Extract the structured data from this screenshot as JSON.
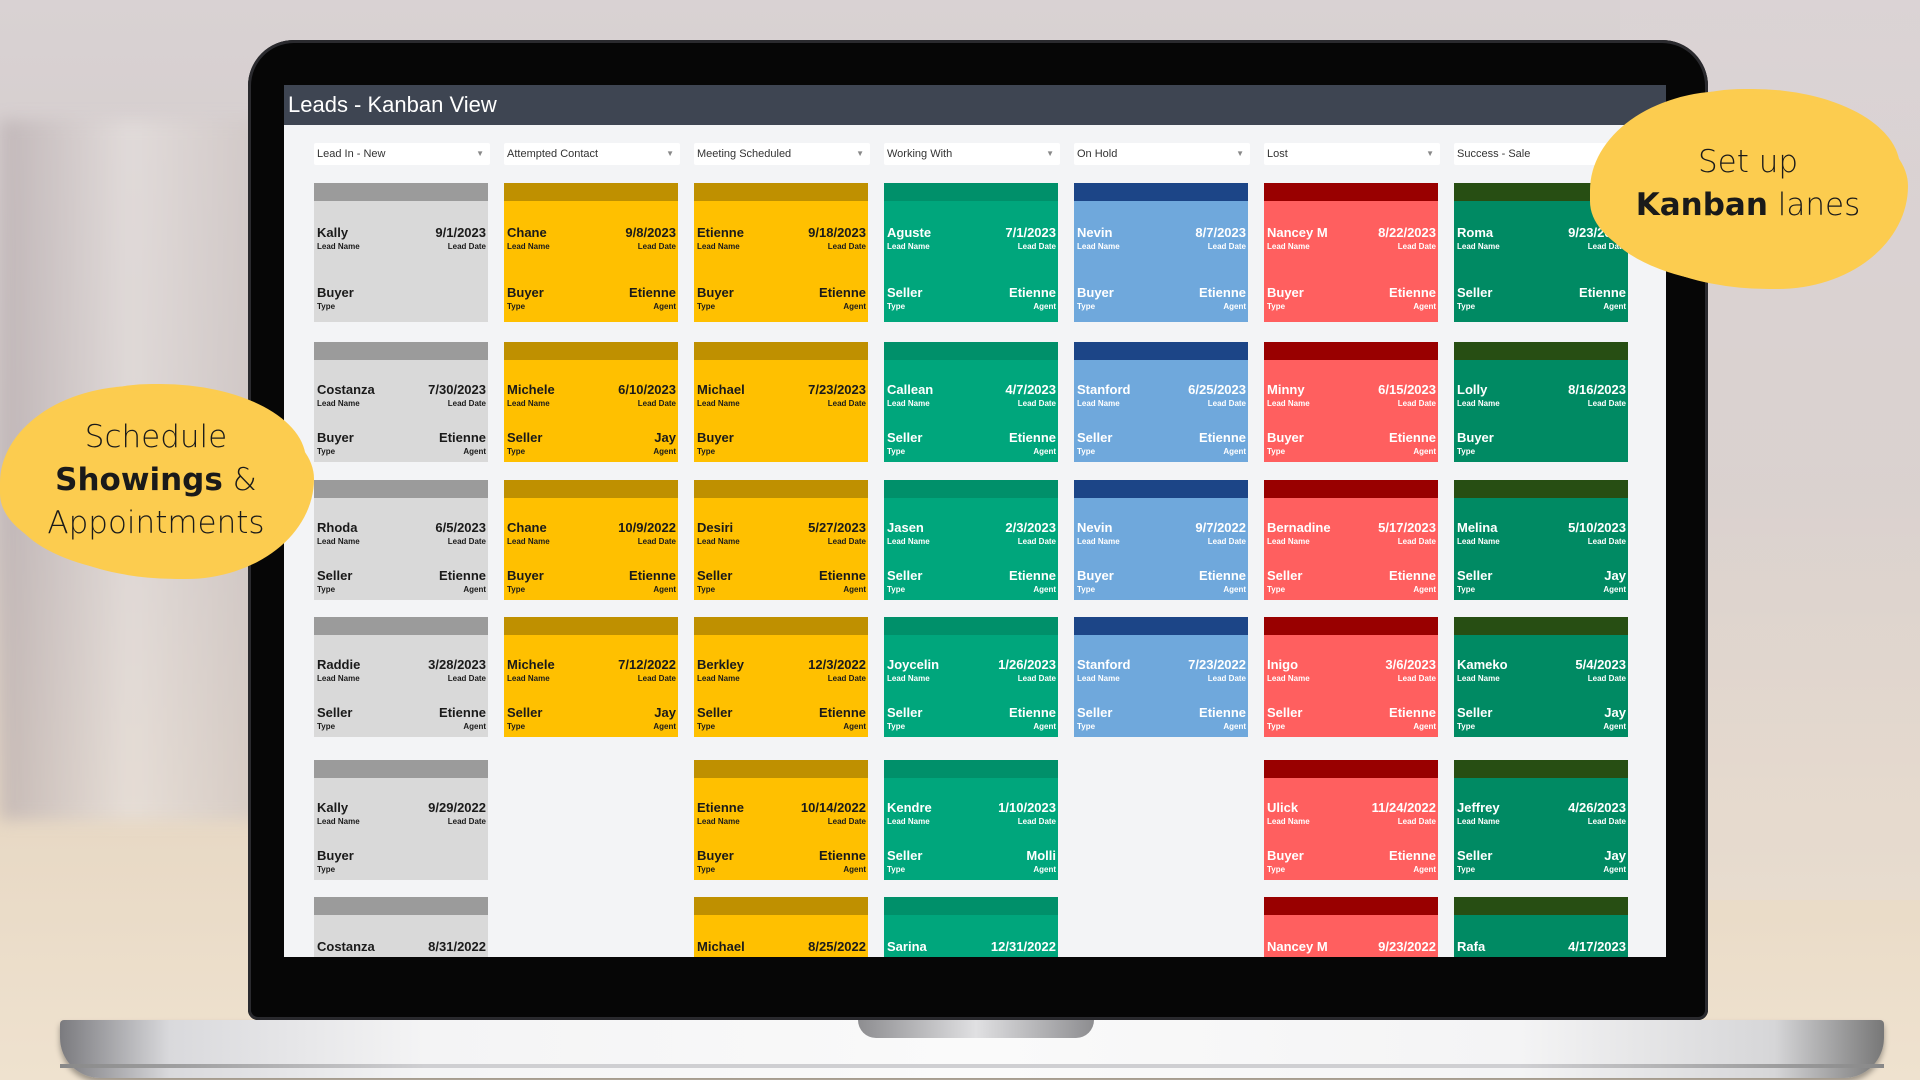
{
  "app": {
    "title": "Leads - Kanban View"
  },
  "labels": {
    "lead_name": "Lead Name",
    "lead_date": "Lead Date",
    "type": "Type",
    "agent": "Agent"
  },
  "icons": {
    "dropdown": "chevron-down-icon"
  },
  "lanes": [
    {
      "label": "Lead In - New",
      "header_color": "#9b9b9b",
      "card_color": "#d9d9d9",
      "text_color": "#1a1a1a",
      "cards": [
        {
          "name": "Kally",
          "date": "9/1/2023",
          "type": "Buyer",
          "agent": ""
        },
        {
          "name": "Costanza",
          "date": "7/30/2023",
          "type": "Buyer",
          "agent": "Etienne"
        },
        {
          "name": "Rhoda",
          "date": "6/5/2023",
          "type": "Seller",
          "agent": "Etienne"
        },
        {
          "name": "Raddie",
          "date": "3/28/2023",
          "type": "Seller",
          "agent": "Etienne"
        },
        {
          "name": "Kally",
          "date": "9/29/2022",
          "type": "Buyer",
          "agent": ""
        },
        {
          "name": "Costanza",
          "date": "8/31/2022",
          "type": "",
          "agent": ""
        }
      ]
    },
    {
      "label": "Attempted Contact",
      "header_color": "#bf9000",
      "card_color": "#ffc000",
      "text_color": "#1a1a1a",
      "cards": [
        {
          "name": "Chane",
          "date": "9/8/2023",
          "type": "Buyer",
          "agent": "Etienne"
        },
        {
          "name": "Michele",
          "date": "6/10/2023",
          "type": "Seller",
          "agent": "Jay"
        },
        {
          "name": "Chane",
          "date": "10/9/2022",
          "type": "Buyer",
          "agent": "Etienne"
        },
        {
          "name": "Michele",
          "date": "7/12/2022",
          "type": "Seller",
          "agent": "Jay"
        }
      ]
    },
    {
      "label": "Meeting Scheduled",
      "header_color": "#bf9000",
      "card_color": "#ffc000",
      "text_color": "#1a1a1a",
      "cards": [
        {
          "name": "Etienne",
          "date": "9/18/2023",
          "type": "Buyer",
          "agent": "Etienne"
        },
        {
          "name": "Michael",
          "date": "7/23/2023",
          "type": "Buyer",
          "agent": ""
        },
        {
          "name": "Desiri",
          "date": "5/27/2023",
          "type": "Seller",
          "agent": "Etienne"
        },
        {
          "name": "Berkley",
          "date": "12/3/2022",
          "type": "Seller",
          "agent": "Etienne"
        },
        {
          "name": "Etienne",
          "date": "10/14/2022",
          "type": "Buyer",
          "agent": "Etienne"
        },
        {
          "name": "Michael",
          "date": "8/25/2022",
          "type": "",
          "agent": ""
        }
      ]
    },
    {
      "label": "Working With",
      "header_color": "#00906a",
      "card_color": "#00a67c",
      "text_color": "#ffffff",
      "cards": [
        {
          "name": "Aguste",
          "date": "7/1/2023",
          "type": "Seller",
          "agent": "Etienne"
        },
        {
          "name": "Callean",
          "date": "4/7/2023",
          "type": "Seller",
          "agent": "Etienne"
        },
        {
          "name": "Jasen",
          "date": "2/3/2023",
          "type": "Seller",
          "agent": "Etienne"
        },
        {
          "name": "Joycelin",
          "date": "1/26/2023",
          "type": "Seller",
          "agent": "Etienne"
        },
        {
          "name": "Kendre",
          "date": "1/10/2023",
          "type": "Seller",
          "agent": "Molli"
        },
        {
          "name": "Sarina",
          "date": "12/31/2022",
          "type": "",
          "agent": ""
        }
      ]
    },
    {
      "label": "On Hold",
      "header_color": "#1c4587",
      "card_color": "#6fa8dc",
      "text_color": "#ffffff",
      "cards": [
        {
          "name": "Nevin",
          "date": "8/7/2023",
          "type": "Buyer",
          "agent": "Etienne"
        },
        {
          "name": "Stanford",
          "date": "6/25/2023",
          "type": "Seller",
          "agent": "Etienne"
        },
        {
          "name": "Nevin",
          "date": "9/7/2022",
          "type": "Buyer",
          "agent": "Etienne"
        },
        {
          "name": "Stanford",
          "date": "7/23/2022",
          "type": "Seller",
          "agent": "Etienne"
        }
      ]
    },
    {
      "label": "Lost",
      "header_color": "#990000",
      "card_color": "#ff5f5f",
      "text_color": "#ffffff",
      "cards": [
        {
          "name": "Nancey M",
          "date": "8/22/2023",
          "type": "Buyer",
          "agent": "Etienne"
        },
        {
          "name": "Minny",
          "date": "6/15/2023",
          "type": "Buyer",
          "agent": "Etienne"
        },
        {
          "name": "Bernadine",
          "date": "5/17/2023",
          "type": "Seller",
          "agent": "Etienne"
        },
        {
          "name": "Inigo",
          "date": "3/6/2023",
          "type": "Seller",
          "agent": "Etienne"
        },
        {
          "name": "Ulick",
          "date": "11/24/2022",
          "type": "Buyer",
          "agent": "Etienne"
        },
        {
          "name": "Nancey M",
          "date": "9/23/2022",
          "type": "",
          "agent": ""
        }
      ]
    },
    {
      "label": "Success - Sale",
      "header_color": "#274e13",
      "card_color": "#008a63",
      "text_color": "#ffffff",
      "cards": [
        {
          "name": "Roma",
          "date": "9/23/2023",
          "type": "Seller",
          "agent": "Etienne"
        },
        {
          "name": "Lolly",
          "date": "8/16/2023",
          "type": "Buyer",
          "agent": ""
        },
        {
          "name": "Melina",
          "date": "5/10/2023",
          "type": "Seller",
          "agent": "Jay"
        },
        {
          "name": "Kameko",
          "date": "5/4/2023",
          "type": "Seller",
          "agent": "Jay"
        },
        {
          "name": "Jeffrey",
          "date": "4/26/2023",
          "type": "Seller",
          "agent": "Jay"
        },
        {
          "name": "Rafa",
          "date": "4/17/2023",
          "type": "",
          "agent": ""
        }
      ]
    }
  ],
  "callouts": {
    "left": {
      "line1": "Schedule",
      "bold": "Showings",
      "line2_rest": " &",
      "line3": "Appointments"
    },
    "right": {
      "line1": "Set up",
      "bold": "Kanban",
      "line2_rest": " lanes"
    }
  }
}
